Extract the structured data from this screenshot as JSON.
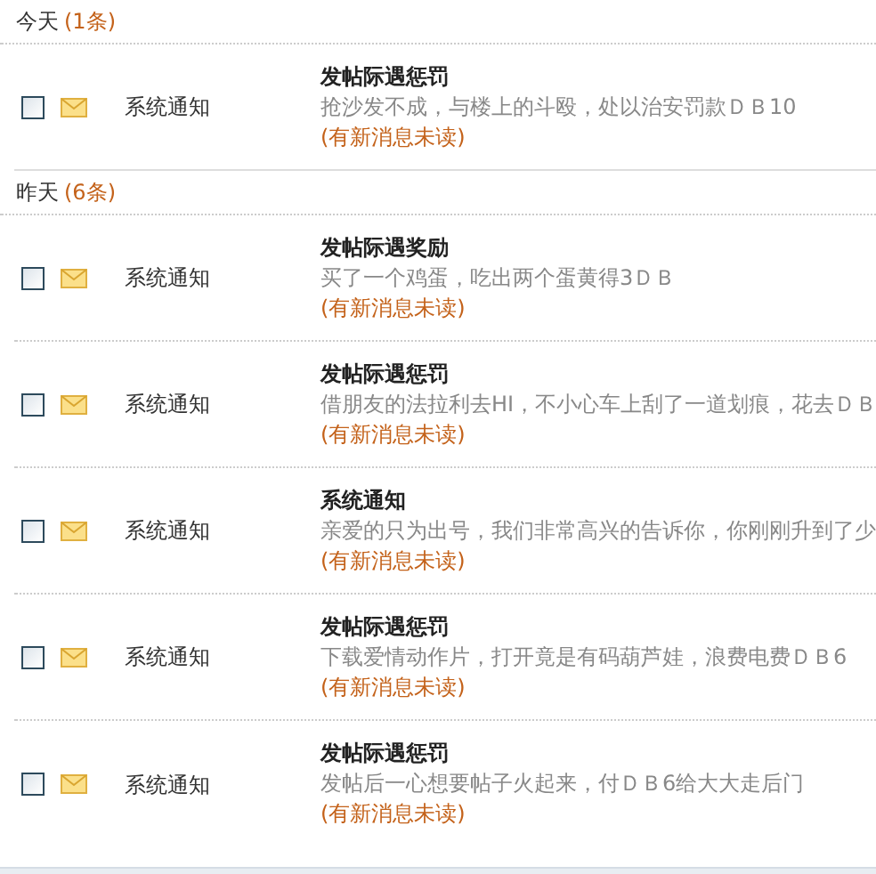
{
  "groups": [
    {
      "label": "今天",
      "count": "(1条)",
      "messages": [
        {
          "checked": false,
          "sender": "系统通知",
          "title": "发帖际遇惩罚",
          "body": "抢沙发不成，与楼上的斗殴，处以治安罚款ＤＢ10",
          "status": "(有新消息未读)"
        }
      ]
    },
    {
      "label": "昨天",
      "count": "(6条)",
      "messages": [
        {
          "checked": false,
          "sender": "系统通知",
          "title": "发帖际遇奖励",
          "body": "买了一个鸡蛋，吃出两个蛋黄得3ＤＢ",
          "status": "(有新消息未读)"
        },
        {
          "checked": false,
          "sender": "系统通知",
          "title": "发帖际遇惩罚",
          "body": "借朋友的法拉利去HI，不小心车上刮了一道划痕，花去ＤＢ",
          "status": "(有新消息未读)"
        },
        {
          "checked": false,
          "sender": "系统通知",
          "title": "系统通知",
          "body": "亲爱的只为出号，我们非常高兴的告诉你，你刚刚升到了少",
          "status": "(有新消息未读)"
        },
        {
          "checked": false,
          "sender": "系统通知",
          "title": "发帖际遇惩罚",
          "body": "下载爱情动作片，打开竟是有码葫芦娃，浪费电费ＤＢ6",
          "status": "(有新消息未读)"
        },
        {
          "checked": false,
          "sender": "系统通知",
          "title": "发帖际遇惩罚",
          "body": "发帖后一心想要帖子火起来，付ＤＢ6给大大走后门",
          "status": "(有新消息未读)"
        }
      ]
    }
  ]
}
